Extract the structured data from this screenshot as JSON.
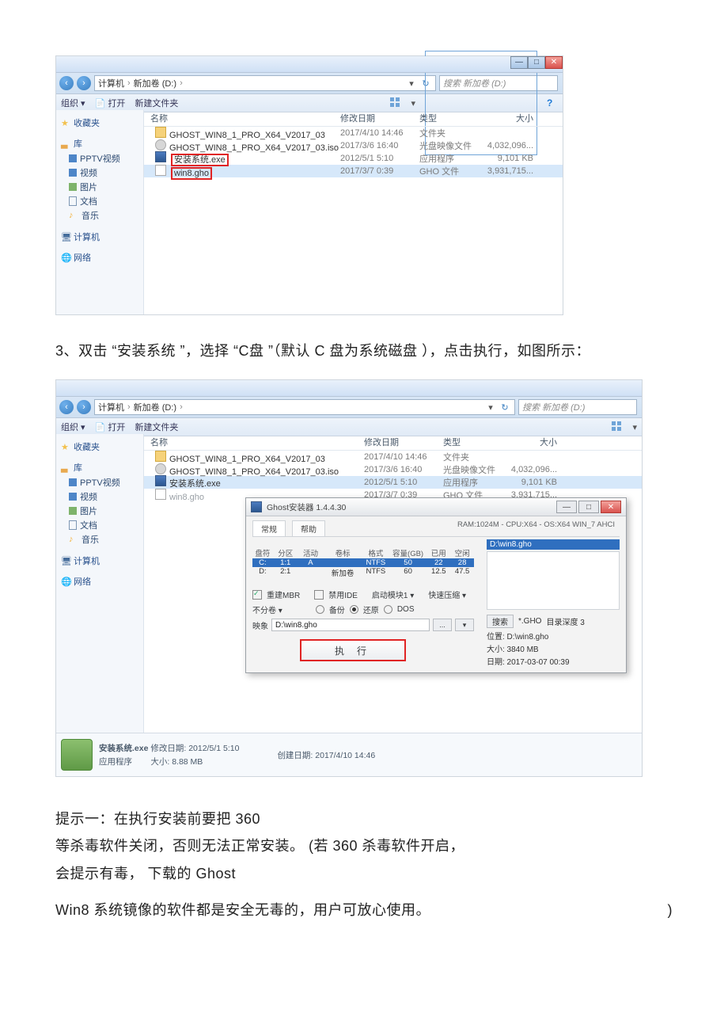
{
  "explorer": {
    "breadcrumb": {
      "root": "计算机",
      "drive": "新加卷 (D:)"
    },
    "search_placeholder": "搜索 新加卷 (D:)",
    "toolbar": {
      "organize": "组织 ▾",
      "open": "打开",
      "newfolder": "新建文件夹"
    },
    "columns": {
      "name": "名称",
      "date": "修改日期",
      "type": "类型",
      "size": "大小"
    },
    "sidebar": {
      "fav": "收藏夹",
      "lib": "库",
      "pptv": "PPTV视频",
      "video": "视频",
      "pic": "图片",
      "doc": "文档",
      "music": "音乐",
      "pc": "计算机",
      "net": "网络"
    },
    "files": [
      {
        "name": "GHOST_WIN8_1_PRO_X64_V2017_03",
        "date": "2017/4/10 14:46",
        "type": "文件夹",
        "size": ""
      },
      {
        "name": "GHOST_WIN8_1_PRO_X64_V2017_03.iso",
        "date": "2017/3/6 16:40",
        "type": "光盘映像文件",
        "size": "4,032,096..."
      },
      {
        "name": "安装系统.exe",
        "date": "2012/5/1 5:10",
        "type": "应用程序",
        "size": "9,101 KB"
      },
      {
        "name": "win8.gho",
        "date": "2017/3/7 0:39",
        "type": "GHO 文件",
        "size": "3,931,715..."
      }
    ]
  },
  "step3": "3、双击 “安装系统 ”，选择  “C盘 ”（默认 C 盘为系统磁盘 ），点击执行，如图所示：",
  "ghost": {
    "title": "Ghost安装器 1.4.4.30",
    "winctrls": {
      "min": "—",
      "max": "□",
      "close": "✕"
    },
    "tabs": {
      "normal": "常规",
      "help": "帮助"
    },
    "raminfo": "RAM:1024M - CPU:X64 - OS:X64 WIN_7 AHCI",
    "tblhead": {
      "drive": "盘符",
      "part": "分区",
      "act": "活动",
      "label": "卷标",
      "fmt": "格式",
      "cap": "容量(GB)",
      "used": "已用",
      "free": "空闲"
    },
    "rows": [
      {
        "drive": "C:",
        "part": "1:1",
        "act": "A",
        "label": "",
        "fmt": "NTFS",
        "cap": "50",
        "used": "22",
        "free": "28"
      },
      {
        "drive": "D:",
        "part": "2:1",
        "act": "",
        "label": "新加卷",
        "fmt": "NTFS",
        "cap": "60",
        "used": "12.5",
        "free": "47.5"
      }
    ],
    "opts": {
      "rebuildMBR": "重建MBR",
      "disableIDE": "禁用IDE",
      "bootModule": "启动模块1 ▾",
      "fastComp": "快速压缩 ▾",
      "nosplit": "不分卷 ▾",
      "backup": "备份",
      "restore": "还原",
      "dos": "DOS",
      "imgLabel": "映象",
      "imgPath": "D:\\win8.gho",
      "browse": "...",
      "drop": "▾",
      "exec": "执行"
    },
    "right": {
      "path": "D:\\win8.gho",
      "searchBtn": "搜索",
      "ext": "*.GHO",
      "depth": "目录深度 3",
      "loc": "位置: D:\\win8.gho",
      "size": "大小: 3840 MB",
      "date": "日期: 2017-03-07  00:39"
    }
  },
  "details": {
    "name": "安装系统.exe",
    "type": "应用程序",
    "moddate_label": "修改日期:",
    "moddate": "2012/5/1 5:10",
    "size_label": "大小:",
    "size": "8.88 MB",
    "created_label": "创建日期:",
    "created": "2017/4/10 14:46"
  },
  "tip": {
    "l1": "提示一：在执行安装前要把 360",
    "l2": "等杀毒软件关闭，否则无法正常安装。 (若 360 杀毒软件开启，",
    "l3": "会提示有毒， 下载的 Ghost",
    "l4_a": "Win8 系统镜像的软件都是安全无毒的，用户可放心使用。",
    "l4_b": ")"
  }
}
